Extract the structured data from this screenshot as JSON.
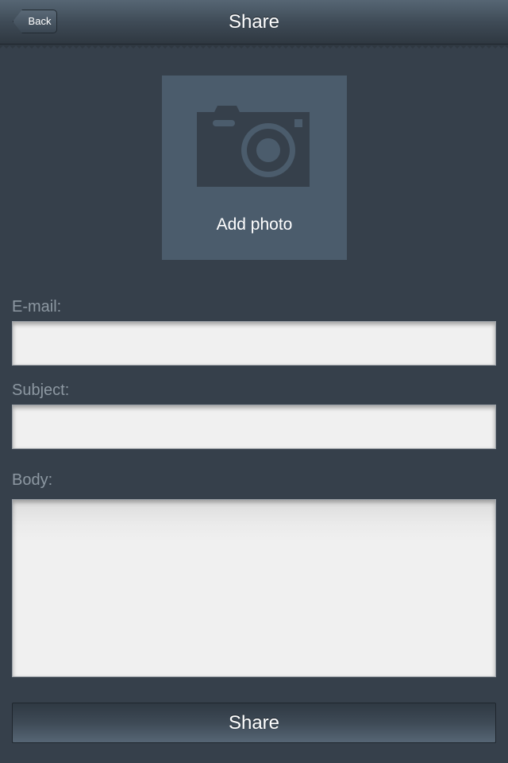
{
  "navbar": {
    "title": "Share",
    "back_label": "Back"
  },
  "photo": {
    "icon": "camera-icon",
    "label": "Add photo"
  },
  "form": {
    "email_label": "E-mail:",
    "email_value": "",
    "subject_label": "Subject:",
    "subject_value": "",
    "body_label": "Body:",
    "body_value": ""
  },
  "actions": {
    "share_label": "Share"
  },
  "colors": {
    "background": "#36404b",
    "photo_tile": "#4b5c6c",
    "label_text": "#8d98a2",
    "input_background": "#f0f0f0"
  }
}
